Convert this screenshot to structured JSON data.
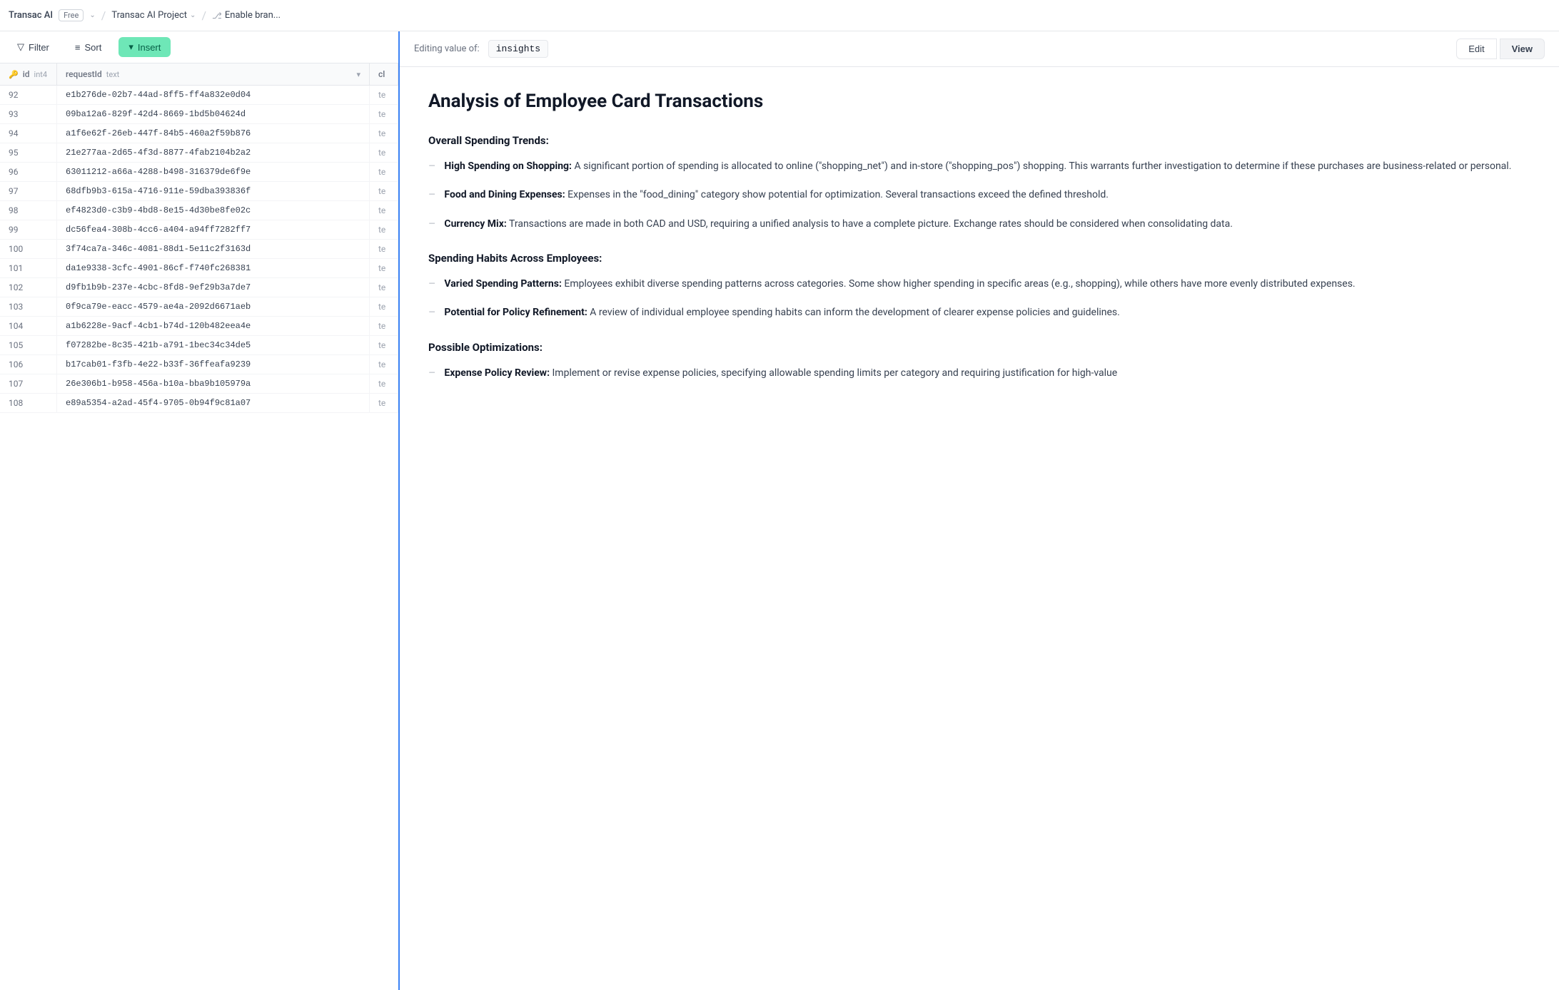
{
  "topNav": {
    "brand": "Transac AI",
    "badge": "Free",
    "project": "Transac AI Project",
    "branch": "Enable bran..."
  },
  "toolbar": {
    "filter_label": "Filter",
    "sort_label": "Sort",
    "insert_label": "Insert"
  },
  "table": {
    "columns": [
      {
        "label": "id",
        "type": "int4",
        "key": true
      },
      {
        "label": "requestId",
        "type": "text",
        "key": false
      },
      {
        "label": "cl",
        "type": "",
        "key": false
      }
    ],
    "rows": [
      {
        "id": "92",
        "uuid": "e1b276de-02b7-44ad-8ff5-ff4a832e0d04",
        "extra": "te"
      },
      {
        "id": "93",
        "uuid": "09ba12a6-829f-42d4-8669-1bd5b04624d",
        "extra": "te"
      },
      {
        "id": "94",
        "uuid": "a1f6e62f-26eb-447f-84b5-460a2f59b876",
        "extra": "te"
      },
      {
        "id": "95",
        "uuid": "21e277aa-2d65-4f3d-8877-4fab2104b2a2",
        "extra": "te"
      },
      {
        "id": "96",
        "uuid": "63011212-a66a-4288-b498-316379de6f9e",
        "extra": "te"
      },
      {
        "id": "97",
        "uuid": "68dfb9b3-615a-4716-911e-59dba393836f",
        "extra": "te"
      },
      {
        "id": "98",
        "uuid": "ef4823d0-c3b9-4bd8-8e15-4d30be8fe02c",
        "extra": "te"
      },
      {
        "id": "99",
        "uuid": "dc56fea4-308b-4cc6-a404-a94ff7282ff7",
        "extra": "te"
      },
      {
        "id": "100",
        "uuid": "3f74ca7a-346c-4081-88d1-5e11c2f3163d",
        "extra": "te"
      },
      {
        "id": "101",
        "uuid": "da1e9338-3cfc-4901-86cf-f740fc268381",
        "extra": "te"
      },
      {
        "id": "102",
        "uuid": "d9fb1b9b-237e-4cbc-8fd8-9ef29b3a7de7",
        "extra": "te"
      },
      {
        "id": "103",
        "uuid": "0f9ca79e-eacc-4579-ae4a-2092d6671aeb",
        "extra": "te"
      },
      {
        "id": "104",
        "uuid": "a1b6228e-9acf-4cb1-b74d-120b482eea4e",
        "extra": "te"
      },
      {
        "id": "105",
        "uuid": "f07282be-8c35-421b-a791-1bec34c34de5",
        "extra": "te"
      },
      {
        "id": "106",
        "uuid": "b17cab01-f3fb-4e22-b33f-36ffeafa9239",
        "extra": "te"
      },
      {
        "id": "107",
        "uuid": "26e306b1-b958-456a-b10a-bba9b105979a",
        "extra": "te"
      },
      {
        "id": "108",
        "uuid": "e89a5354-a2ad-45f4-9705-0b94f9c81a07",
        "extra": "te"
      }
    ]
  },
  "editor": {
    "editing_label": "Editing value of:",
    "editing_value": "insights",
    "edit_btn": "Edit",
    "view_btn": "View",
    "content": {
      "title": "Analysis of Employee Card Transactions",
      "sections": [
        {
          "heading": "Overall Spending Trends:",
          "items": [
            {
              "bold": "High Spending on Shopping:",
              "text": " A significant portion of spending is allocated to online (\"shopping_net\") and in-store (\"shopping_pos\") shopping. This warrants further investigation to determine if these purchases are business-related or personal."
            },
            {
              "bold": "Food and Dining Expenses:",
              "text": " Expenses in the \"food_dining\" category show potential for optimization. Several transactions exceed the defined threshold."
            },
            {
              "bold": "Currency Mix:",
              "text": " Transactions are made in both CAD and USD, requiring a unified analysis to have a complete picture. Exchange rates should be considered when consolidating data."
            }
          ]
        },
        {
          "heading": "Spending Habits Across Employees:",
          "items": [
            {
              "bold": "Varied Spending Patterns:",
              "text": " Employees exhibit diverse spending patterns across categories. Some show higher spending in specific areas (e.g., shopping), while others have more evenly distributed expenses."
            },
            {
              "bold": "Potential for Policy Refinement:",
              "text": " A review of individual employee spending habits can inform the development of clearer expense policies and guidelines."
            }
          ]
        },
        {
          "heading": "Possible Optimizations:",
          "items": [
            {
              "bold": "Expense Policy Review:",
              "text": " Implement or revise expense policies, specifying allowable spending limits per category and requiring justification for high-value"
            }
          ]
        }
      ]
    }
  }
}
